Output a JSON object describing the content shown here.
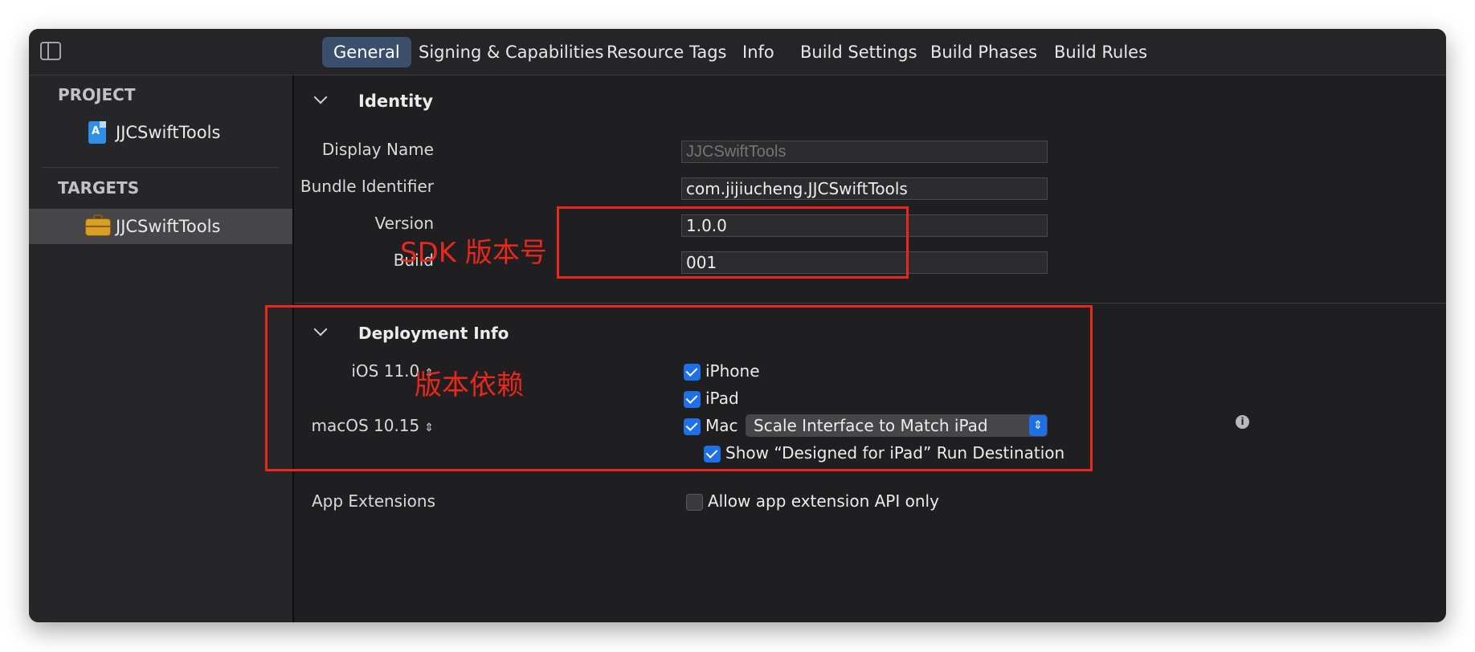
{
  "toolbar": {
    "tabs": [
      "General",
      "Signing & Capabilities",
      "Resource Tags",
      "Info",
      "Build Settings",
      "Build Phases",
      "Build Rules"
    ],
    "active_tab": "General"
  },
  "sidebar": {
    "project_header": "PROJECT",
    "project_item": "JJCSwiftTools",
    "targets_header": "TARGETS",
    "target_item": "JJCSwiftTools"
  },
  "identity": {
    "section_title": "Identity",
    "display_name_label": "Display Name",
    "display_name_placeholder": "JJCSwiftTools",
    "bundle_id_label": "Bundle Identifier",
    "bundle_id_value": "com.jijiucheng.JJCSwiftTools",
    "version_label": "Version",
    "version_value": "1.0.0",
    "build_label": "Build",
    "build_value": "001"
  },
  "deployment": {
    "section_title": "Deployment Info",
    "ios_version": "iOS 11.0",
    "macos_version": "macOS 10.15",
    "iphone_label": "iPhone",
    "iphone_checked": true,
    "ipad_label": "iPad",
    "ipad_checked": true,
    "mac_label": "Mac",
    "mac_checked": true,
    "mac_popup_value": "Scale Interface to Match iPad",
    "designed_for_ipad_label": "Show “Designed for iPad” Run Destination",
    "designed_for_ipad_checked": true
  },
  "app_extensions": {
    "label": "App Extensions",
    "checkbox_label": "Allow app extension API only",
    "checked": false
  },
  "annotations": {
    "sdk_version": "SDK 版本号",
    "version_dependency": "版本依赖",
    "color": "#e8281b"
  },
  "icons": {
    "sidebar_toggle": "sidebar-toggle-icon",
    "project": "xcode-project-icon",
    "target": "toolbox-icon",
    "info": "info-icon",
    "stepper": "stepper-arrows-icon"
  }
}
